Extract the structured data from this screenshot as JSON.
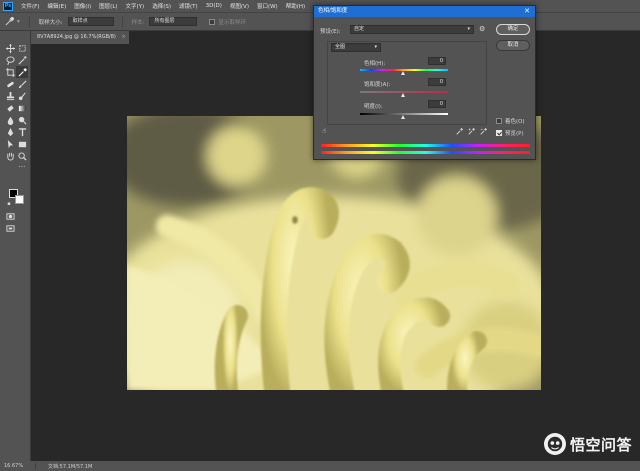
{
  "menu": {
    "logo": "Ps",
    "items": [
      "文件(F)",
      "编辑(E)",
      "图像(I)",
      "图层(L)",
      "文字(Y)",
      "选择(S)",
      "滤镜(T)",
      "3D(D)",
      "视图(V)",
      "窗口(W)",
      "帮助(H)"
    ]
  },
  "options": {
    "sample_label": "取样大小:",
    "sample_value": "取样点",
    "sample_all_label": "样本:",
    "sample_all_value": "所有图层",
    "ring_label": "显示取样环"
  },
  "document": {
    "tab_title": "8V7A8924.jpg @ 16.7%(RGB/8)",
    "close": "×"
  },
  "status": {
    "zoom": "16.67%",
    "doc": "文档:57.1M/57.1M"
  },
  "dialog": {
    "title": "色相/饱和度",
    "close": "✕",
    "preset_label": "预设(E):",
    "preset_value": "自定",
    "channel_value": "全图",
    "ok_label": "确定",
    "cancel_label": "取消",
    "hue_label": "色相(H):",
    "hue_value": "0",
    "saturation_label": "饱和度(A):",
    "saturation_value": "0",
    "lightness_label": "明度(I):",
    "lightness_value": "0",
    "colorize_label": "着色(O)",
    "colorize_checked": false,
    "preview_label": "预览(P)",
    "preview_checked": true
  },
  "watermark": {
    "text": "悟空问答"
  },
  "colors": {
    "title_bar": "#1f6ed4",
    "panel": "#535353",
    "canvas_bg": "#282828",
    "accent_yellow": "#f3ee9e"
  }
}
